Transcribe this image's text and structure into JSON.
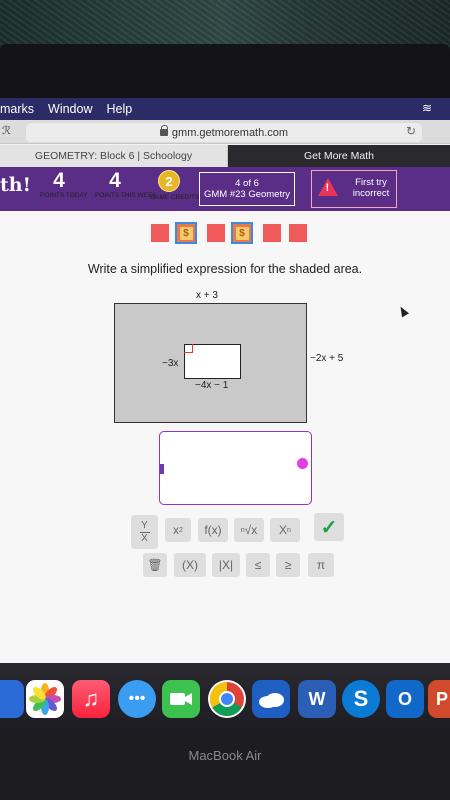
{
  "menubar": {
    "items": [
      "marks",
      "Window",
      "Help"
    ]
  },
  "browser": {
    "url": "gmm.getmoremath.com",
    "tab_active": "GEOMETRY: Block 6 | Schoology",
    "tab_other": "Get More Math"
  },
  "header": {
    "brand": "th!",
    "points_today_value": "4",
    "points_today_label": "POINTS TODAY",
    "points_week_value": "4",
    "points_week_label": "POINTS THIS WEEK",
    "game_credits_value": "2",
    "game_credits_label": "GAME CREDITS",
    "progress_line1": "4 of 6",
    "progress_line2": "GMM #23 Geometry",
    "alert_text": "First try incorrect",
    "accent_color": "#5a2d86"
  },
  "problem": {
    "prompt": "Write a simplified expression for the shaded area.",
    "outer_top_label": "x + 3",
    "outer_right_label": "−2x + 5",
    "inner_left_label": "−3x",
    "inner_bottom_label": "−4x − 1"
  },
  "keypad": {
    "frac_top": "Y",
    "frac_bottom": "X",
    "sq": "x",
    "func": "f(x)",
    "root": "√",
    "sub": "X",
    "parens": "(X)",
    "abs": "|X|",
    "le": "≤",
    "ge": "≥",
    "pi": "π"
  },
  "device": {
    "label": "MacBook Air"
  }
}
